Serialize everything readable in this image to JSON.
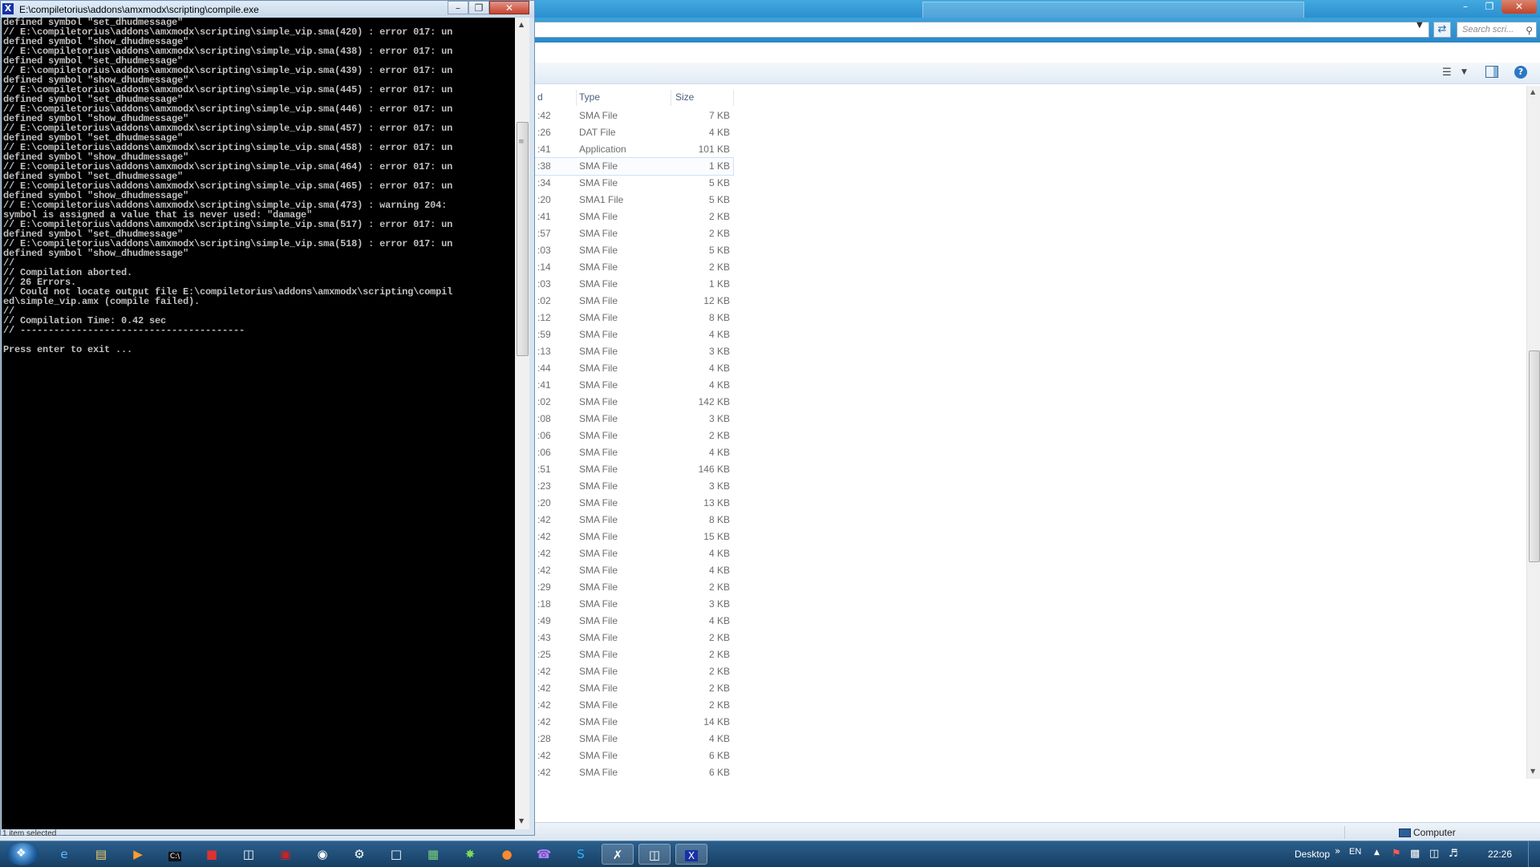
{
  "explorer": {
    "search_placeholder": "Search scri...",
    "columns": {
      "date": "d",
      "type": "Type",
      "size": "Size"
    },
    "rows": [
      {
        "date": ":42",
        "type": "SMA File",
        "size": "7 KB"
      },
      {
        "date": ":26",
        "type": "DAT File",
        "size": "4 KB"
      },
      {
        "date": ":41",
        "type": "Application",
        "size": "101 KB"
      },
      {
        "date": ":38",
        "type": "SMA File",
        "size": "1 KB"
      },
      {
        "date": ":34",
        "type": "SMA File",
        "size": "5 KB"
      },
      {
        "date": ":20",
        "type": "SMA1 File",
        "size": "5 KB"
      },
      {
        "date": ":41",
        "type": "SMA File",
        "size": "2 KB"
      },
      {
        "date": ":57",
        "type": "SMA File",
        "size": "2 KB"
      },
      {
        "date": ":03",
        "type": "SMA File",
        "size": "5 KB"
      },
      {
        "date": ":14",
        "type": "SMA File",
        "size": "2 KB"
      },
      {
        "date": ":03",
        "type": "SMA File",
        "size": "1 KB"
      },
      {
        "date": ":02",
        "type": "SMA File",
        "size": "12 KB"
      },
      {
        "date": ":12",
        "type": "SMA File",
        "size": "8 KB"
      },
      {
        "date": ":59",
        "type": "SMA File",
        "size": "4 KB"
      },
      {
        "date": ":13",
        "type": "SMA File",
        "size": "3 KB"
      },
      {
        "date": ":44",
        "type": "SMA File",
        "size": "4 KB"
      },
      {
        "date": ":41",
        "type": "SMA File",
        "size": "4 KB"
      },
      {
        "date": ":02",
        "type": "SMA File",
        "size": "142 KB"
      },
      {
        "date": ":08",
        "type": "SMA File",
        "size": "3 KB"
      },
      {
        "date": ":06",
        "type": "SMA File",
        "size": "2 KB"
      },
      {
        "date": ":06",
        "type": "SMA File",
        "size": "4 KB"
      },
      {
        "date": ":51",
        "type": "SMA File",
        "size": "146 KB"
      },
      {
        "date": ":23",
        "type": "SMA File",
        "size": "3 KB"
      },
      {
        "date": ":20",
        "type": "SMA File",
        "size": "13 KB"
      },
      {
        "date": ":42",
        "type": "SMA File",
        "size": "8 KB"
      },
      {
        "date": ":42",
        "type": "SMA File",
        "size": "15 KB"
      },
      {
        "date": ":42",
        "type": "SMA File",
        "size": "4 KB"
      },
      {
        "date": ":42",
        "type": "SMA File",
        "size": "4 KB"
      },
      {
        "date": ":29",
        "type": "SMA File",
        "size": "2 KB"
      },
      {
        "date": ":18",
        "type": "SMA File",
        "size": "3 KB"
      },
      {
        "date": ":49",
        "type": "SMA File",
        "size": "4 KB"
      },
      {
        "date": ":43",
        "type": "SMA File",
        "size": "2 KB"
      },
      {
        "date": ":25",
        "type": "SMA File",
        "size": "2 KB"
      },
      {
        "date": ":42",
        "type": "SMA File",
        "size": "2 KB"
      },
      {
        "date": ":42",
        "type": "SMA File",
        "size": "2 KB"
      },
      {
        "date": ":42",
        "type": "SMA File",
        "size": "2 KB"
      },
      {
        "date": ":42",
        "type": "SMA File",
        "size": "14 KB"
      },
      {
        "date": ":28",
        "type": "SMA File",
        "size": "4 KB"
      },
      {
        "date": ":42",
        "type": "SMA File",
        "size": "6 KB"
      },
      {
        "date": ":42",
        "type": "SMA File",
        "size": "6 KB"
      }
    ],
    "highlighted_row": 3,
    "status_computer": "Computer"
  },
  "console": {
    "title": "E:\\compiletorius\\addons\\amxmodx\\scripting\\compile.exe",
    "lines": [
      "defined symbol \"set_dhudmessage\"",
      "// E:\\compiletorius\\addons\\amxmodx\\scripting\\simple_vip.sma(420) : error 017: un",
      "defined symbol \"show_dhudmessage\"",
      "// E:\\compiletorius\\addons\\amxmodx\\scripting\\simple_vip.sma(438) : error 017: un",
      "defined symbol \"set_dhudmessage\"",
      "// E:\\compiletorius\\addons\\amxmodx\\scripting\\simple_vip.sma(439) : error 017: un",
      "defined symbol \"show_dhudmessage\"",
      "// E:\\compiletorius\\addons\\amxmodx\\scripting\\simple_vip.sma(445) : error 017: un",
      "defined symbol \"set_dhudmessage\"",
      "// E:\\compiletorius\\addons\\amxmodx\\scripting\\simple_vip.sma(446) : error 017: un",
      "defined symbol \"show_dhudmessage\"",
      "// E:\\compiletorius\\addons\\amxmodx\\scripting\\simple_vip.sma(457) : error 017: un",
      "defined symbol \"set_dhudmessage\"",
      "// E:\\compiletorius\\addons\\amxmodx\\scripting\\simple_vip.sma(458) : error 017: un",
      "defined symbol \"show_dhudmessage\"",
      "// E:\\compiletorius\\addons\\amxmodx\\scripting\\simple_vip.sma(464) : error 017: un",
      "defined symbol \"set_dhudmessage\"",
      "// E:\\compiletorius\\addons\\amxmodx\\scripting\\simple_vip.sma(465) : error 017: un",
      "defined symbol \"show_dhudmessage\"",
      "// E:\\compiletorius\\addons\\amxmodx\\scripting\\simple_vip.sma(473) : warning 204:",
      "symbol is assigned a value that is never used: \"damage\"",
      "// E:\\compiletorius\\addons\\amxmodx\\scripting\\simple_vip.sma(517) : error 017: un",
      "defined symbol \"set_dhudmessage\"",
      "// E:\\compiletorius\\addons\\amxmodx\\scripting\\simple_vip.sma(518) : error 017: un",
      "defined symbol \"show_dhudmessage\"",
      "//",
      "// Compilation aborted.",
      "// 26 Errors.",
      "// Could not locate output file E:\\compiletorius\\addons\\amxmodx\\scripting\\compil",
      "ed\\simple_vip.amx (compile failed).",
      "//",
      "// Compilation Time: 0.42 sec",
      "// ----------------------------------------",
      "",
      "Press enter to exit ..."
    ],
    "bottom_text": "1 item selected"
  },
  "taskbar": {
    "desktop_label": "Desktop",
    "language": "EN",
    "clock": "22:26"
  }
}
